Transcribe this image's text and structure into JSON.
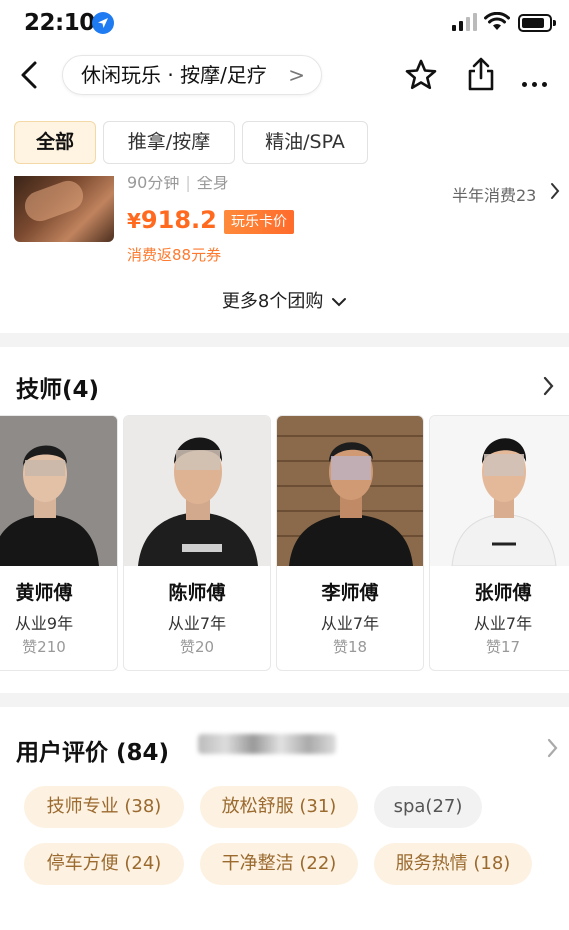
{
  "status_bar": {
    "time": "22:10"
  },
  "nav": {
    "breadcrumb": "休闲玩乐 · 按摩/足疗",
    "breadcrumb_chevron": ">"
  },
  "filter_tabs": [
    {
      "label": "全部",
      "active": true
    },
    {
      "label": "推拿/按摩",
      "active": false
    },
    {
      "label": "精油/SPA",
      "active": false
    }
  ],
  "deal": {
    "duration": "90分钟",
    "scope": "全身",
    "currency": "¥",
    "price": "918.2",
    "badge": "玩乐卡价",
    "coupon": "消费返88元券",
    "sold": "半年消费23",
    "more_deals": "更多8个团购"
  },
  "technicians": {
    "title": "技师(4)",
    "items": [
      {
        "name": "黄师傅",
        "years": "从业9年",
        "likes": "赞210"
      },
      {
        "name": "陈师傅",
        "years": "从业7年",
        "likes": "赞20"
      },
      {
        "name": "李师傅",
        "years": "从业7年",
        "likes": "赞18"
      },
      {
        "name": "张师傅",
        "years": "从业7年",
        "likes": "赞17"
      }
    ]
  },
  "reviews": {
    "title": "用户评价 (84)",
    "tags": [
      {
        "label": "技师专业 (38)"
      },
      {
        "label": "放松舒服 (31)"
      },
      {
        "label": "spa(27)"
      },
      {
        "label": "停车方便 (24)"
      },
      {
        "label": "干净整洁 (22)"
      },
      {
        "label": "服务热情 (18)"
      }
    ]
  },
  "colors": {
    "accent_orange": "#ff6a1f",
    "tag_bg": "#fdf1e1",
    "active_tab_bg": "#fff4e1",
    "location_blue": "#1f7bf2"
  }
}
